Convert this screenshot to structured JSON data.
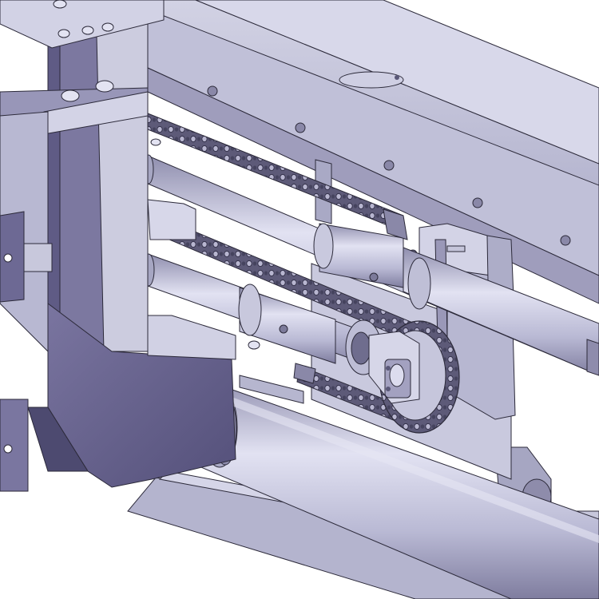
{
  "scene": {
    "background": "#ffffff",
    "colors": {
      "dark_frame": "#6f6a8c",
      "dark_frame_shade": "#57537a",
      "frame_light": "#c4c4da",
      "frame_mid": "#aaaac6",
      "frame_shadow": "#8d8aaa",
      "rod_light": "#dedef0",
      "rod_mid": "#b7b7d2",
      "rod_dark": "#8f8eae",
      "chain": "#55536e",
      "chain_light": "#9a98b6",
      "outline": "#2c2a3a"
    },
    "parts": [
      "left-vertical-frame",
      "upper-horizontal-beam",
      "lower-base-plate",
      "upper-guide-rod",
      "middle-guide-rod",
      "lower-cylinder",
      "upper-roller-chain",
      "lower-roller-chain",
      "sprocket-assembly",
      "right-mounting-bracket",
      "hex-nuts"
    ]
  }
}
